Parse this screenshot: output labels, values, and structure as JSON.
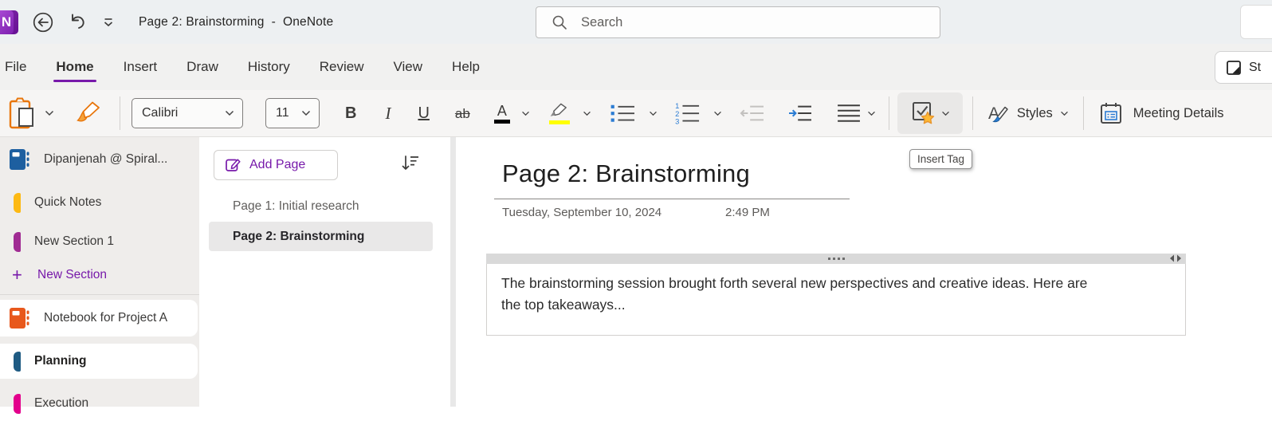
{
  "titlebar": {
    "window_title": "Page 2: Brainstorming  -  OneNote",
    "logo_letter": "N",
    "search_placeholder": "Search"
  },
  "menubar": {
    "items": [
      "File",
      "Home",
      "Insert",
      "Draw",
      "History",
      "Review",
      "View",
      "Help"
    ],
    "active_item": "Home",
    "clip_button_label": "St"
  },
  "toolbar": {
    "font_name": "Calibri",
    "font_size": "11",
    "glyphs": {
      "bold": "B",
      "italic": "I",
      "underline": "U",
      "strikethrough": "ab",
      "font_color": "A",
      "num1": "1",
      "num2": "2",
      "num3": "3",
      "styles_a": "A"
    },
    "styles_label": "Styles",
    "meeting_details_label": "Meeting Details",
    "insert_tag_tooltip": "Insert Tag"
  },
  "sidebar": {
    "account_notebook": "Dipanjenah @ Spiral...",
    "sections_top": [
      {
        "label": "Quick Notes",
        "color": "#fdb913"
      },
      {
        "label": "New Section 1",
        "color": "#a02b93"
      }
    ],
    "new_section_label": "New Section",
    "project_notebook": "Notebook for Project A",
    "project_sections": [
      {
        "label": "Planning",
        "color": "#1f5b83"
      },
      {
        "label": "Execution",
        "color": "#e3008c"
      }
    ]
  },
  "pages": {
    "add_page_label": "Add Page",
    "items": [
      {
        "label": "Page 1: Initial research"
      },
      {
        "label": "Page 2: Brainstorming"
      }
    ]
  },
  "content": {
    "page_title": "Page 2: Brainstorming",
    "date": "Tuesday, September 10, 2024",
    "time": "2:49 PM",
    "paragraph_lines": [
      "The brainstorming session brought forth several new perspectives and creative ideas. Here are",
      "the top takeaways..."
    ]
  },
  "colors": {
    "accent_purple": "#7719aa",
    "titlebar_bg": "#edf0f2",
    "ribbon_bg": "#f6f5f4",
    "sidebar_bg": "#efedeb",
    "selected_page_bg": "#e9e8e8",
    "account_notebook_blue": "#1d5fa0",
    "project_notebook_orange": "#e8581c",
    "list_icon_blue": "#2b7cd3",
    "highlight_yellow": "#ffff00",
    "font_color_swatch": "#000000",
    "tag_star_gold": "#fdb933"
  }
}
